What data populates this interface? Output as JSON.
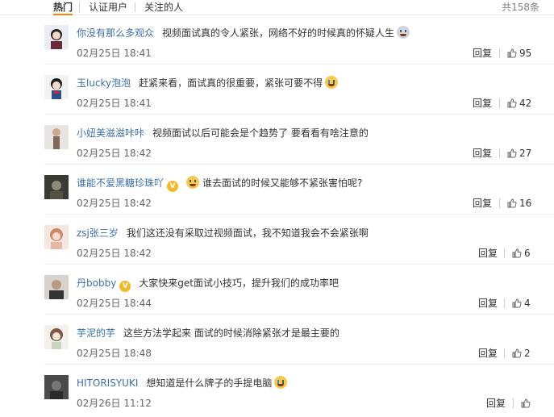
{
  "tabs": [
    {
      "label": "热门",
      "active": true
    },
    {
      "label": "认证用户",
      "active": false
    },
    {
      "label": "关注的人",
      "active": false
    }
  ],
  "total_count": "共158条",
  "reply_label": "回复",
  "comments": [
    {
      "user": "你没有那么多观众",
      "vip": false,
      "text": "视频面试真的令人紧张，网络不好的时候真的怀疑人生",
      "emoji": "skull-icon",
      "time": "02月25日 18:41",
      "likes": "95"
    },
    {
      "user": "玉lucky泡泡",
      "vip": false,
      "text": "赶紧来看，面试真的很重要，紧张可要不得",
      "emoji": "crying-face-icon",
      "time": "02月25日 18:41",
      "likes": "42"
    },
    {
      "user": "小妞美滋滋咔咔",
      "vip": false,
      "text": "视频面试以后可能会是个趋势了 要看看有啥注意的",
      "emoji": "",
      "time": "02月25日 18:42",
      "likes": "27"
    },
    {
      "user": "谁能不爱黑糖珍珠吖",
      "vip": true,
      "text": "谁去面试的时候又能够不紧张害怕呢?",
      "emoji": "laughing-crying-icon",
      "time": "02月25日 18:42",
      "likes": "16"
    },
    {
      "user": "zsj张三岁",
      "vip": false,
      "text": "我们这还没有采取过视频面试，我不知道我会不会紧张啊",
      "emoji": "",
      "time": "02月25日 18:42",
      "likes": "6"
    },
    {
      "user": "丹bobby",
      "vip": true,
      "text": "大家快来get面试小技巧，提升我们的成功率吧",
      "emoji": "",
      "time": "02月25日 18:44",
      "likes": "4"
    },
    {
      "user": "芋泥的芋",
      "vip": false,
      "text": "这些方法学起来 面试的时候消除紧张才是最主要的",
      "emoji": "",
      "time": "02月25日 18:48",
      "likes": "2"
    },
    {
      "user": "HITORISYUKI",
      "vip": false,
      "text": "想知道是什么牌子的手提电脑",
      "emoji": "crying-face-icon",
      "time": "02月26日 11:12",
      "likes": ""
    }
  ],
  "colors": {
    "username": "#3d6fa8",
    "tab_accent": "#ff8200"
  }
}
